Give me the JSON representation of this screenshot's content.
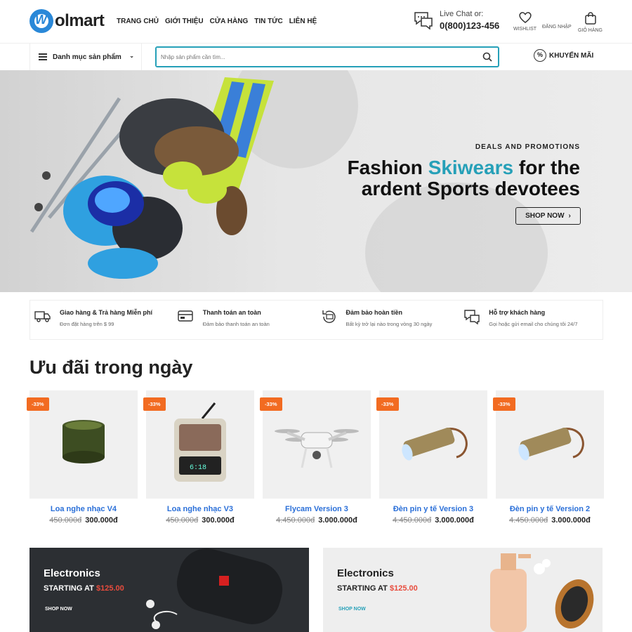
{
  "brand": {
    "name": "olmart",
    "mark": "W"
  },
  "nav": [
    "TRANG CHỦ",
    "GIỚI THIỆU",
    "CỬA HÀNG",
    "TIN TỨC",
    "LIÊN HỆ"
  ],
  "live_chat": {
    "label": "Live Chat or:",
    "phone": "0(800)123-456"
  },
  "actions": {
    "wishlist": "WISHLIST",
    "login": "ĐĂNG NHẬP",
    "cart": "GIỎ HÀNG"
  },
  "category_menu": {
    "label": "Danh mục sản phẩm"
  },
  "search": {
    "placeholder": "Nhập sản phẩm cần tìm..."
  },
  "promo": {
    "label": "KHUYẾN MÃI",
    "icon": "percent-badge-icon"
  },
  "hero": {
    "eyebrow": "DEALS AND PROMOTIONS",
    "title_pre": "Fashion ",
    "title_highlight": "Skiwears",
    "title_post": " for the ardent Sports devotees",
    "button": "SHOP NOW",
    "accent_color": "#26a0b8"
  },
  "features": [
    {
      "title": "Giao hàng & Trả hàng Miễn phí",
      "desc": "Đơn đặt hàng trên $ 99",
      "icon": "truck-icon"
    },
    {
      "title": "Thanh toán an toàn",
      "desc": "Đảm bảo thanh toán an toàn",
      "icon": "card-icon"
    },
    {
      "title": "Đảm bảo hoàn tiền",
      "desc": "Bất kỳ trở lại nào trong vòng 30 ngày",
      "icon": "money-back-icon"
    },
    {
      "title": "Hỗ trợ khách hàng",
      "desc": "Gọi hoặc gửi email cho chúng tôi 24/7",
      "icon": "chat-icon"
    }
  ],
  "deals": {
    "title": "Ưu đãi trong ngày",
    "products": [
      {
        "badge": "-33%",
        "name": "Loa nghe nhạc V4",
        "old_price": "450.000đ",
        "price": "300.000đ"
      },
      {
        "badge": "-33%",
        "name": "Loa nghe nhạc V3",
        "old_price": "450.000đ",
        "price": "300.000đ"
      },
      {
        "badge": "-33%",
        "name": "Flycam Version 3",
        "old_price": "4.450.000đ",
        "price": "3.000.000đ"
      },
      {
        "badge": "-33%",
        "name": "Đèn pin y tế Version 3",
        "old_price": "4.450.000đ",
        "price": "3.000.000đ"
      },
      {
        "badge": "-33%",
        "name": "Đèn pin y tế Version 2",
        "old_price": "4.450.000đ",
        "price": "3.000.000đ"
      }
    ]
  },
  "banners": [
    {
      "title": "Electronics",
      "starting": "STARTING AT",
      "price": "$125.00",
      "cta": "SHOP NOW"
    },
    {
      "title": "Electronics",
      "starting": "STARTING AT",
      "price": "$125.00",
      "cta": "SHOP NOW"
    }
  ],
  "colors": {
    "accent": "#26a0b8",
    "badge": "#f26b21",
    "link": "#2a6fd8",
    "price_red": "#e84c3d"
  }
}
